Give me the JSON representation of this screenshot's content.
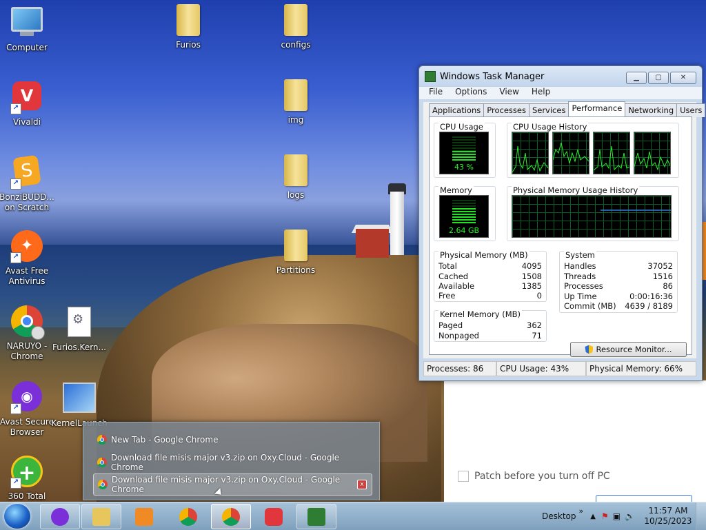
{
  "desktop": {
    "icons": [
      {
        "label": "Computer"
      },
      {
        "label": "Furios"
      },
      {
        "label": "configs"
      },
      {
        "label": "Vivaldi"
      },
      {
        "label": "img"
      },
      {
        "label": "BonziBUDD... on Scratch"
      },
      {
        "label": "logs"
      },
      {
        "label": "Avast Free Antivirus"
      },
      {
        "label": "Partitions"
      },
      {
        "label": "NARUYO - Chrome"
      },
      {
        "label": "Furios.Kern..."
      },
      {
        "label": "Avast Secure Browser"
      },
      {
        "label": "KernelLaunch"
      },
      {
        "label": "360 Total"
      }
    ]
  },
  "background_app": {
    "checkbox_label": "Patch before you turn off PC"
  },
  "task_manager": {
    "title": "Windows Task Manager",
    "menu": [
      "File",
      "Options",
      "View",
      "Help"
    ],
    "tabs": [
      "Applications",
      "Processes",
      "Services",
      "Performance",
      "Networking",
      "Users"
    ],
    "active_tab": "Performance",
    "cpu_usage_label": "CPU Usage",
    "cpu_usage_value": "43 %",
    "cpu_usage_fraction": 0.43,
    "cpu_history_label": "CPU Usage History",
    "memory_label": "Memory",
    "memory_value": "2.64 GB",
    "memory_fraction": 0.66,
    "memory_history_label": "Physical Memory Usage History",
    "physical_memory": {
      "title": "Physical Memory (MB)",
      "rows": [
        {
          "label": "Total",
          "value": "4095"
        },
        {
          "label": "Cached",
          "value": "1508"
        },
        {
          "label": "Available",
          "value": "1385"
        },
        {
          "label": "Free",
          "value": "0"
        }
      ]
    },
    "kernel_memory": {
      "title": "Kernel Memory (MB)",
      "rows": [
        {
          "label": "Paged",
          "value": "362"
        },
        {
          "label": "Nonpaged",
          "value": "71"
        }
      ]
    },
    "system": {
      "title": "System",
      "rows": [
        {
          "label": "Handles",
          "value": "37052"
        },
        {
          "label": "Threads",
          "value": "1516"
        },
        {
          "label": "Processes",
          "value": "86"
        },
        {
          "label": "Up Time",
          "value": "0:00:16:36"
        },
        {
          "label": "Commit (MB)",
          "value": "4639 / 8189"
        }
      ]
    },
    "resource_monitor_button": "Resource Monitor...",
    "status": {
      "processes": "Processes: 86",
      "cpu": "CPU Usage: 43%",
      "memory": "Physical Memory: 66%"
    },
    "colors": {
      "graph_line": "#2cf02c",
      "grid": "#0d5d2b",
      "memory_line": "#2f7fd8"
    }
  },
  "jump_list": {
    "items": [
      {
        "label": "New Tab - Google Chrome"
      },
      {
        "label": "Download file misis major v3.zip on Oxy.Cloud - Google Chrome"
      },
      {
        "label": "Download file misis major v3.zip on Oxy.Cloud - Google Chrome"
      }
    ],
    "close_glyph": "x"
  },
  "taskbar": {
    "desktop_label": "Desktop",
    "chevron": "»",
    "time": "11:57 AM",
    "date": "10/25/2023"
  }
}
